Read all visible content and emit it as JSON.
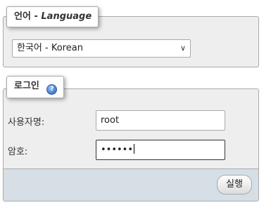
{
  "language_section": {
    "legend_prefix": "언어",
    "legend_dash": "-",
    "legend_english": "Language",
    "select_value": "한국어 - Korean"
  },
  "login_section": {
    "legend": "로그인",
    "help_icon": "help-question-icon",
    "username_label": "사용자명:",
    "username_value": "root",
    "password_label": "암호:",
    "password_value": "••••••",
    "submit_label": "실행"
  },
  "colors": {
    "fieldset_bg": "#eeeeee",
    "footer_bg": "#d6dee6",
    "border": "#aaaaaa"
  }
}
